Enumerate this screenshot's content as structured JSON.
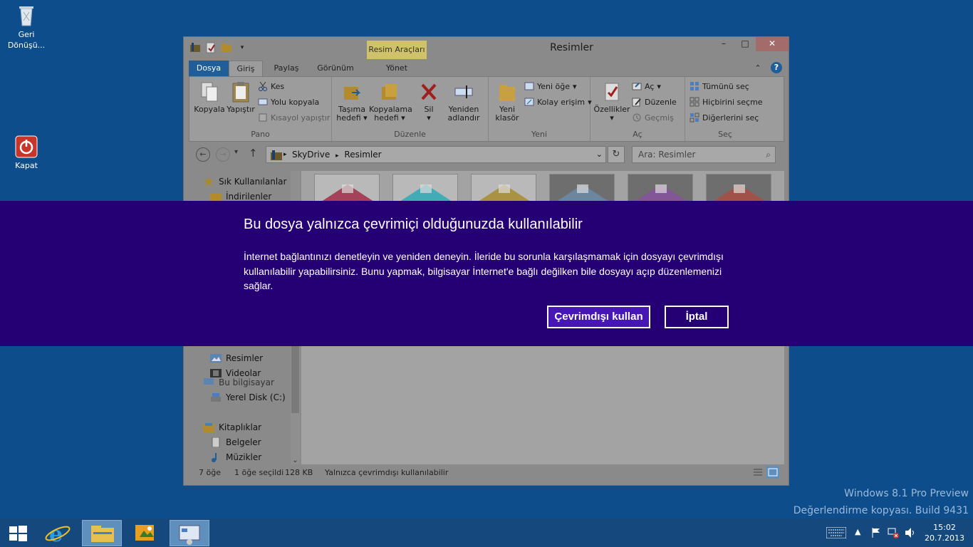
{
  "desktop": {
    "recycle_bin_label": "Geri Dönüşü...",
    "shutdown_label": "Kapat",
    "watermark_line1": "Windows 8.1 Pro Preview",
    "watermark_line2": "Değerlendirme kopyası. Build 9431"
  },
  "window": {
    "title": "Resimler",
    "context_tab": "Resim Araçları",
    "tabs": [
      "Dosya",
      "Giriş",
      "Paylaş",
      "Görünüm",
      "Yönet"
    ],
    "ribbon": {
      "pano": {
        "label": "Pano",
        "copy": "Kopyala",
        "paste": "Yapıştır",
        "cut": "Kes",
        "copy_path": "Yolu kopyala",
        "paste_shortcut": "Kısayol yapıştır"
      },
      "duzenle": {
        "label": "Düzenle",
        "move_to": "Taşıma",
        "move_to2": "hedefi",
        "copy_to": "Kopyalama",
        "copy_to2": "hedefi",
        "delete": "Sil",
        "rename": "Yeniden",
        "rename2": "adlandır"
      },
      "yeni": {
        "label": "Yeni",
        "new_folder": "Yeni",
        "new_folder2": "klasör",
        "new_item": "Yeni öğe",
        "easy_access": "Kolay erişim"
      },
      "ac": {
        "label": "Aç",
        "properties": "Özellikler",
        "open": "Aç",
        "edit": "Düzenle",
        "history": "Geçmiş"
      },
      "sec": {
        "label": "Seç",
        "select_all": "Tümünü seç",
        "select_none": "Hiçbirini seçme",
        "invert": "Diğerlerini seç"
      }
    },
    "address": {
      "path1": "SkyDrive",
      "path2": "Resimler",
      "search_placeholder": "Ara: Resimler"
    },
    "nav": {
      "favorites": "Sık Kullanılanlar",
      "downloads": "İndirilenler",
      "this_pc": "Bu bilgisayar",
      "local_disk": "Yerel Disk (C:)",
      "libraries": "Kitaplıklar",
      "documents": "Belgeler",
      "music": "Müzikler",
      "pictures": "Resimler",
      "videos": "Videolar"
    },
    "status": {
      "count": "7 öğe",
      "selected": "1 öğe seçildi",
      "size": "128 KB",
      "availability": "Yalnızca çevrimdışı kullanılabilir"
    },
    "thumb_colors": [
      "#9c1b3a",
      "#1aa7b5",
      "#a6851c",
      "#6c8fb0",
      "#8a4fa6",
      "#b24a3c"
    ]
  },
  "dialog": {
    "title": "Bu dosya yalnızca çevrimiçi olduğunuzda kullanılabilir",
    "body": "İnternet bağlantınızı denetleyin ve yeniden deneyin. İleride bu sorunla karşılaşmamak için dosyayı çevrimdışı kullanılabilir yapabilirsiniz. Bunu yapmak, bilgisayar İnternet'e bağlı değilken bile dosyayı açıp düzenlemenizi sağlar.",
    "primary_button": "Çevrimdışı kullan",
    "cancel_button": "İptal",
    "background_color": "#250075",
    "primary_color": "#4617b4"
  },
  "taskbar": {
    "time": "15:02",
    "date": "20.7.2013"
  }
}
